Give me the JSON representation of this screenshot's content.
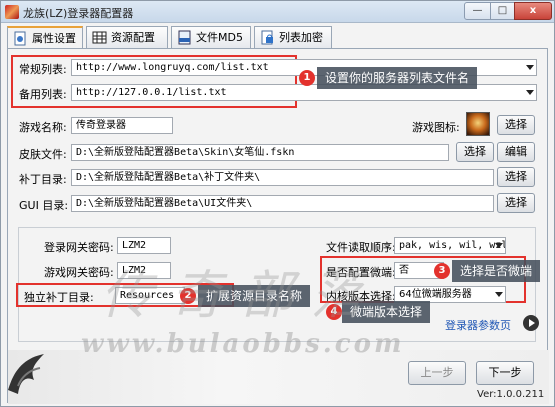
{
  "window": {
    "title": "龙族(LZ)登录器配置器",
    "min_label": "—",
    "max_label": "□",
    "close_label": "x"
  },
  "tabs": [
    {
      "label": "属性设置",
      "icon": "gear-doc-icon",
      "active": true
    },
    {
      "label": "资源配置",
      "icon": "grid-icon"
    },
    {
      "label": "文件MD5",
      "icon": "md5-file-icon"
    },
    {
      "label": "列表加密",
      "icon": "lock-doc-icon"
    }
  ],
  "server_lists": {
    "main_label": "常规列表:",
    "main_value": "http://www.longruyq.com/list.txt",
    "backup_label": "备用列表:",
    "backup_value": "http://127.0.0.1/list.txt"
  },
  "game": {
    "name_label": "游戏名称:",
    "name_value": "传奇登录器",
    "icon_label": "游戏图标:",
    "select_label": "选择"
  },
  "skin": {
    "label": "皮肤文件:",
    "value": "D:\\全新版登陆配置器Beta\\Skin\\女笔仙.fskn",
    "select_label": "选择",
    "edit_label": "编辑"
  },
  "patch": {
    "label": "补丁目录:",
    "value": "D:\\全新版登陆配置器Beta\\补丁文件夹\\",
    "select_label": "选择"
  },
  "gui": {
    "label": "GUI 目录:",
    "value": "D:\\全新版登陆配置器Beta\\UI文件夹\\",
    "select_label": "选择"
  },
  "lower": {
    "login_pw_label": "登录网关密码:",
    "login_pw_value": "LZM2",
    "game_pw_label": "游戏网关密码:",
    "game_pw_value": "LZM2",
    "indep_label": "独立补丁目录:",
    "indep_value": "Resources",
    "read_order_label": "文件读取顺序:",
    "read_order_value": "pak, wis, wil, wzl",
    "micro_label": "是否配置微端:",
    "micro_value": "否",
    "kernel_label": "内核版本选择:",
    "kernel_value": "64位微端服务器",
    "params_link": "登录器参数页"
  },
  "annotations": {
    "c1": {
      "num": "1",
      "text": "设置你的服务器列表文件名"
    },
    "c2": {
      "num": "2",
      "text": "扩展资源目录名称"
    },
    "c3": {
      "num": "3",
      "text": "选择是否微端"
    },
    "c4": {
      "num": "4",
      "text": "微端版本选择"
    }
  },
  "footer": {
    "prev_label": "上一步",
    "next_label": "下一步",
    "version": "Ver:1.0.0.211",
    "watermark": "传奇部落",
    "watermark_url": "www.bulaobbs.com"
  },
  "colors": {
    "annotation_red": "#e3322d",
    "callout_bg": "#46505c",
    "link_blue": "#2057b5"
  }
}
